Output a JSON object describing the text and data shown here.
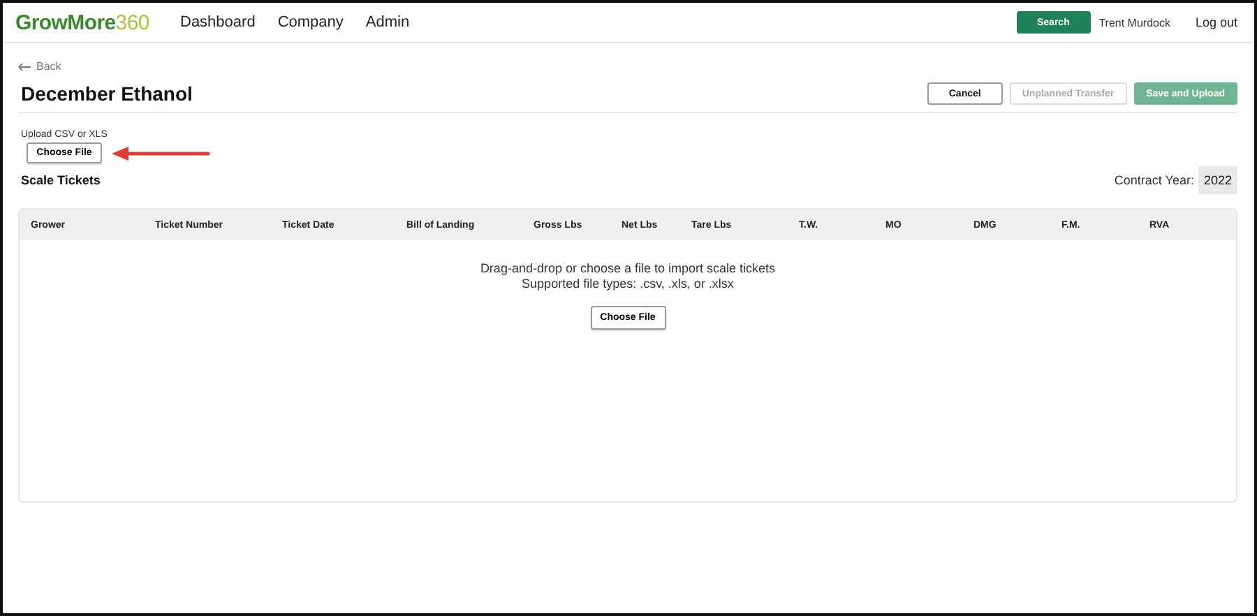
{
  "header": {
    "logo": {
      "word": "GrowMore",
      "number": "360"
    },
    "nav": [
      {
        "label": "Dashboard"
      },
      {
        "label": "Company"
      },
      {
        "label": "Admin"
      }
    ],
    "search_button": "Search",
    "user": "Trent Murdock",
    "logout": "Log out"
  },
  "back": "Back",
  "title": "December Ethanol",
  "actions": [
    {
      "label": "Cancel",
      "kind": "outline",
      "disabled": false
    },
    {
      "label": "Unplanned Transfer",
      "kind": "outline",
      "disabled": true
    },
    {
      "label": "Save and Upload",
      "kind": "primary",
      "disabled": true
    }
  ],
  "upload": {
    "label": "Upload CSV or XLS",
    "button": "Choose File"
  },
  "section_title": "Scale Tickets",
  "contract_year": {
    "label": "Contract Year:",
    "value": "2022"
  },
  "table": {
    "columns": [
      "Grower",
      "Ticket Number",
      "Ticket Date",
      "Bill of Landing",
      "Gross Lbs",
      "Net Lbs",
      "Tare Lbs",
      "T.W.",
      "MO",
      "DMG",
      "F.M.",
      "RVA"
    ],
    "empty": {
      "line_1": "Drag-and-drop or choose a file to import scale tickets",
      "line_2": "Supported file types: .csv, .xls, or .xlsx",
      "button": "Choose File"
    }
  }
}
